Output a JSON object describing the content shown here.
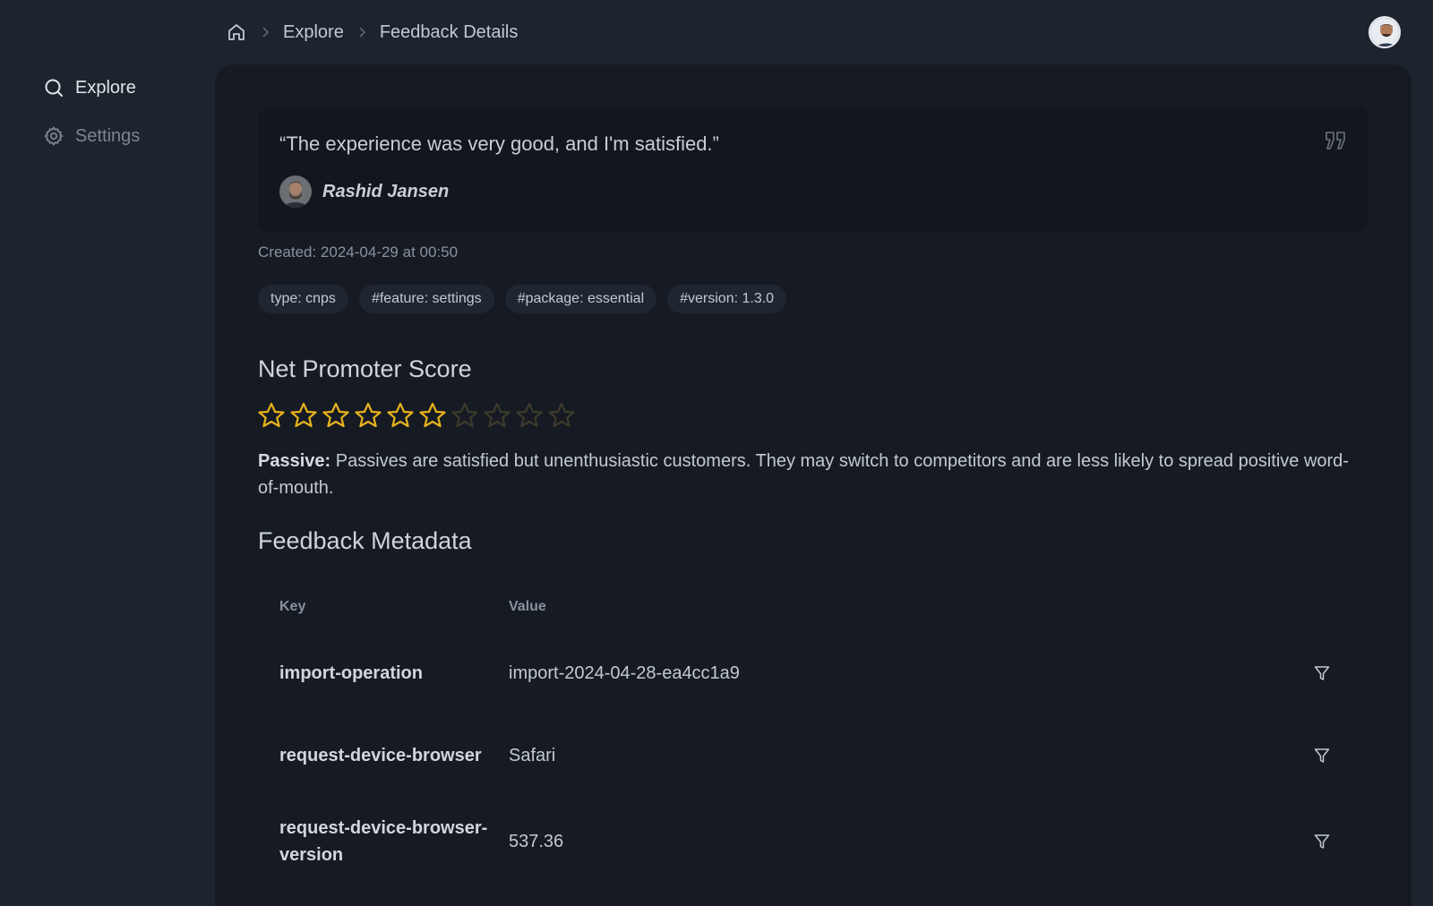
{
  "sidebar": {
    "items": [
      {
        "label": "Explore",
        "icon": "search-icon"
      },
      {
        "label": "Settings",
        "icon": "gear-icon"
      }
    ]
  },
  "breadcrumb": {
    "home_icon": "home-icon",
    "items": [
      "Explore",
      "Feedback Details"
    ]
  },
  "feedback": {
    "quote": "“The experience was very good, and I'm satisfied.”",
    "author": "Rashid Jansen",
    "created": "Created: 2024-04-29 at 00:50",
    "tags": [
      "type: cnps",
      "#feature: settings",
      "#package: essential",
      "#version: 1.3.0"
    ]
  },
  "nps": {
    "title": "Net Promoter Score",
    "score": 6,
    "max": 10,
    "category": "Passive:",
    "description": " Passives are satisfied but unenthusiastic customers. They may switch to competitors and are less likely to spread positive word-of-mouth."
  },
  "metadata": {
    "title": "Feedback Metadata",
    "headers": {
      "key": "Key",
      "value": "Value"
    },
    "rows": [
      {
        "key": "import-operation",
        "value": "import-2024-04-28-ea4cc1a9"
      },
      {
        "key": "request-device-browser",
        "value": "Safari"
      },
      {
        "key": "request-device-browser-version",
        "value": "537.36"
      }
    ]
  },
  "colors": {
    "star_filled": "#e8b21b",
    "star_empty": "#3d3a2c",
    "background": "#1e242e",
    "panel": "#161b23",
    "card": "#12161d"
  }
}
